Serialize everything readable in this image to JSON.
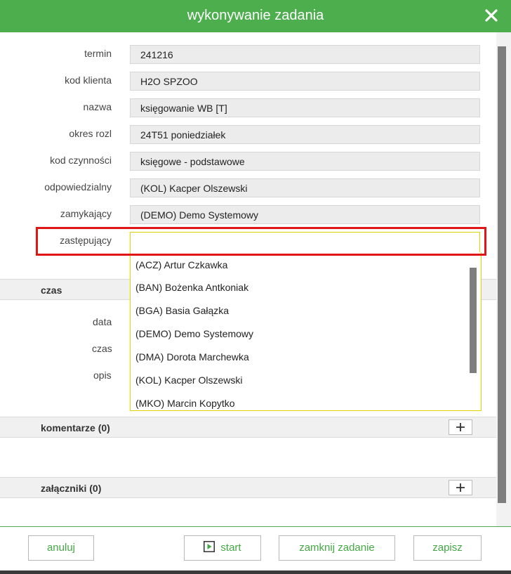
{
  "dialog": {
    "title": "wykonywanie zadania"
  },
  "form": {
    "fields": [
      {
        "label": "termin",
        "value": "241216"
      },
      {
        "label": "kod klienta",
        "value": "H2O SPZOO"
      },
      {
        "label": "nazwa",
        "value": "księgowanie WB [T]"
      },
      {
        "label": "okres rozl",
        "value": "24T51 poniedziałek"
      },
      {
        "label": "kod czynności",
        "value": "księgowe - podstawowe"
      },
      {
        "label": "odpowiedzialny",
        "value": "(KOL) Kacper Olszewski"
      },
      {
        "label": "zamykający",
        "value": "(DEMO) Demo Systemowy"
      },
      {
        "label": "zastępujący",
        "value": ""
      }
    ]
  },
  "dropdown": {
    "options": [
      "(ACZ) Artur Czkawka",
      "(BAN) Bożenka Antkoniak",
      "(BGA) Basia Gałązka",
      "(DEMO) Demo Systemowy",
      "(DMA) Dorota Marchewka",
      "(KOL) Kacper Olszewski",
      "(MKO) Marcin Kopytko"
    ]
  },
  "czas_section": {
    "title": "czas",
    "labels": {
      "data": "data",
      "czas": "czas",
      "opis": "opis"
    }
  },
  "comments_section": {
    "title": "komentarze (0)"
  },
  "attachments_section": {
    "title": "załączniki (0)"
  },
  "footer": {
    "cancel": "anuluj",
    "start": "start",
    "close_task": "zamknij zadanie",
    "save": "zapisz"
  },
  "colors": {
    "accent": "#4cae4c",
    "highlight": "#e01515",
    "focus_border": "#e0d400"
  }
}
